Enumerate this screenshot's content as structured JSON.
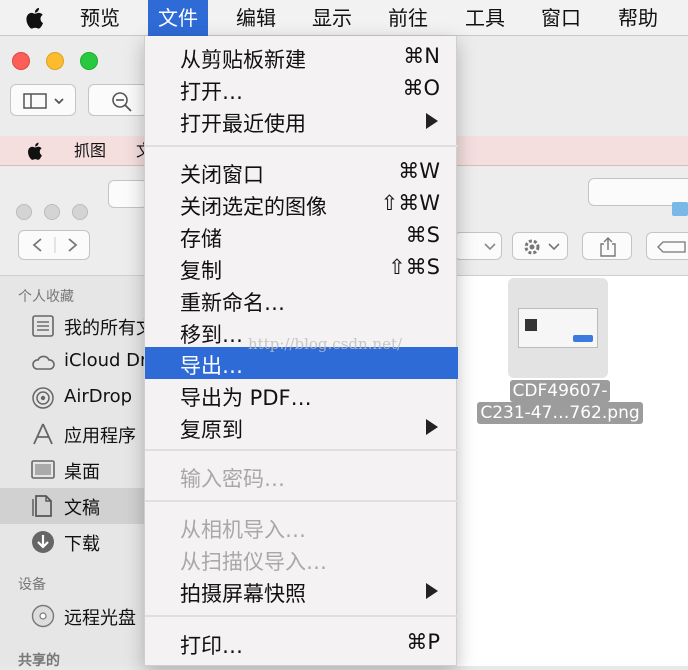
{
  "menubar": {
    "items": [
      "预览",
      "文件",
      "编辑",
      "显示",
      "前往",
      "工具",
      "窗口",
      "帮助"
    ],
    "active_index": 1
  },
  "menubar2": {
    "items": [
      "抓图",
      "文"
    ]
  },
  "colors": {
    "highlight": "#2f6bd6",
    "menu_bg": "#f4f2f2",
    "disabled_text": "#a8a8a8"
  },
  "file_menu": {
    "items": [
      {
        "label": "从剪贴板新建",
        "shortcut": "⌘N"
      },
      {
        "label": "打开…",
        "shortcut": "⌘O"
      },
      {
        "label": "打开最近使用",
        "submenu": true
      },
      {
        "label": "关闭窗口",
        "shortcut": "⌘W"
      },
      {
        "label": "关闭选定的图像",
        "shortcut": "⇧⌘W"
      },
      {
        "label": "存储",
        "shortcut": "⌘S"
      },
      {
        "label": "复制",
        "shortcut": "⇧⌘S"
      },
      {
        "label": "重新命名…"
      },
      {
        "label": "移到…"
      },
      {
        "label": "导出…",
        "highlighted": true
      },
      {
        "label": "导出为 PDF…"
      },
      {
        "label": "复原到",
        "submenu": true
      },
      {
        "label": "输入密码…",
        "disabled": true
      },
      {
        "label": "从相机导入…",
        "disabled": true
      },
      {
        "label": "从扫描仪导入…",
        "disabled": true
      },
      {
        "label": "拍摄屏幕快照",
        "submenu": true
      },
      {
        "label": "打印…",
        "shortcut": "⌘P"
      }
    ]
  },
  "sidebar": {
    "favorites_header": "个人收藏",
    "favorites": [
      "我的所有文",
      "iCloud Dr",
      "AirDrop",
      "应用程序",
      "桌面",
      "文稿",
      "下载"
    ],
    "selected_index": 5,
    "devices_header": "设备",
    "devices": [
      "远程光盘"
    ],
    "shared_header": "共享的"
  },
  "file": {
    "name_line1": "CDF49607-",
    "name_line2": "C231-47…762.png"
  },
  "watermark": "http://blog.csdn.net/"
}
